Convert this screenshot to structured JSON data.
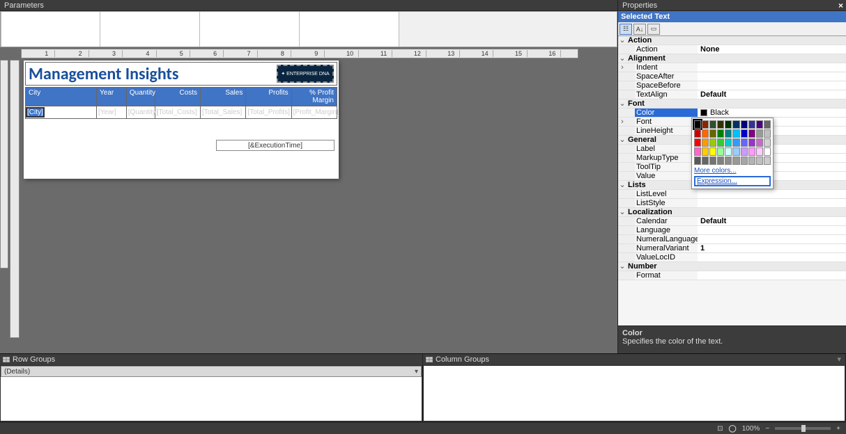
{
  "parameters_panel": {
    "title": "Parameters"
  },
  "report": {
    "title": "Management Insights",
    "logo_text": "✦ ENTERPRISE DNA",
    "columns": [
      "City",
      "Year",
      "Quantity",
      "Costs",
      "Sales",
      "Profits",
      "% Profit Margin"
    ],
    "detail_row": [
      "[City]",
      "[Year]",
      "[Quantity]",
      "[Total_Costs]",
      "[Total_Sales]",
      "[Total_Profits]",
      "[Profit_Margin]"
    ],
    "exec_time": "[&ExecutionTime]"
  },
  "ruler": [
    "",
    "1",
    "",
    "2",
    "",
    "3",
    "",
    "4",
    "",
    "5",
    "",
    "6",
    "",
    "7",
    "",
    "8",
    "",
    "9",
    "",
    "10",
    "",
    "11",
    "",
    "12",
    "",
    "13",
    "",
    "14",
    "",
    "15",
    "",
    "16",
    ""
  ],
  "groups": {
    "row_title": "Row Groups",
    "col_title": "Column Groups",
    "row_items": [
      "(Details)"
    ]
  },
  "properties": {
    "panel_title": "Properties",
    "selected_text": "Selected Text",
    "help_name": "Color",
    "help_text": "Specifies the color of the text.",
    "rows": [
      {
        "t": "cat",
        "label": "Action"
      },
      {
        "t": "p",
        "k": "Action",
        "v": "None",
        "bold": true
      },
      {
        "t": "cat",
        "label": "Alignment"
      },
      {
        "t": "p",
        "k": "Indent",
        "v": "",
        "exp": true
      },
      {
        "t": "p",
        "k": "SpaceAfter",
        "v": ""
      },
      {
        "t": "p",
        "k": "SpaceBefore",
        "v": ""
      },
      {
        "t": "p",
        "k": "TextAlign",
        "v": "Default",
        "bold": true
      },
      {
        "t": "cat",
        "label": "Font"
      },
      {
        "t": "p",
        "k": "Color",
        "v": "Black",
        "sel": true,
        "swatch": "#000"
      },
      {
        "t": "p",
        "k": "Font",
        "v": "",
        "exp": true
      },
      {
        "t": "p",
        "k": "LineHeight",
        "v": ""
      },
      {
        "t": "cat",
        "label": "General"
      },
      {
        "t": "p",
        "k": "Label",
        "v": ""
      },
      {
        "t": "p",
        "k": "MarkupType",
        "v": ""
      },
      {
        "t": "p",
        "k": "ToolTip",
        "v": ""
      },
      {
        "t": "p",
        "k": "Value",
        "v": ""
      },
      {
        "t": "cat",
        "label": "Lists"
      },
      {
        "t": "p",
        "k": "ListLevel",
        "v": ""
      },
      {
        "t": "p",
        "k": "ListStyle",
        "v": ""
      },
      {
        "t": "cat",
        "label": "Localization"
      },
      {
        "t": "p",
        "k": "Calendar",
        "v": "Default",
        "bold": true
      },
      {
        "t": "p",
        "k": "Language",
        "v": ""
      },
      {
        "t": "p",
        "k": "NumeralLanguage",
        "v": ""
      },
      {
        "t": "p",
        "k": "NumeralVariant",
        "v": "1",
        "bold": true
      },
      {
        "t": "p",
        "k": "ValueLocID",
        "v": ""
      },
      {
        "t": "cat",
        "label": "Number"
      },
      {
        "t": "p",
        "k": "Format",
        "v": ""
      }
    ]
  },
  "color_popup": {
    "rows": [
      [
        "#000000",
        "#8b2500",
        "#2f4f2f",
        "#333300",
        "#003300",
        "#003366",
        "#000080",
        "#333399",
        "#4b0082",
        "#666666"
      ],
      [
        "#cc0000",
        "#ff6600",
        "#666600",
        "#008000",
        "#008080",
        "#00bfff",
        "#0000cc",
        "#800080",
        "#999999",
        "#c0c0c0"
      ],
      [
        "#ff0000",
        "#ff9900",
        "#99cc00",
        "#33cc33",
        "#00cccc",
        "#3399ff",
        "#6666ff",
        "#9933cc",
        "#cc66cc",
        "#d3d3d3"
      ],
      [
        "#ff66cc",
        "#ffcc00",
        "#ffff00",
        "#99ff99",
        "#ccffff",
        "#99ccff",
        "#cc99ff",
        "#ff99ff",
        "#ffccff",
        "#ffffff"
      ],
      [
        "#595959",
        "#666666",
        "#737373",
        "#808080",
        "#8c8c8c",
        "#999999",
        "#a6a6a6",
        "#b3b3b3",
        "#bfbfbf",
        "#cccccc"
      ]
    ],
    "more": "More colors...",
    "expr": "Expression..."
  },
  "status": {
    "zoom": "100%"
  }
}
